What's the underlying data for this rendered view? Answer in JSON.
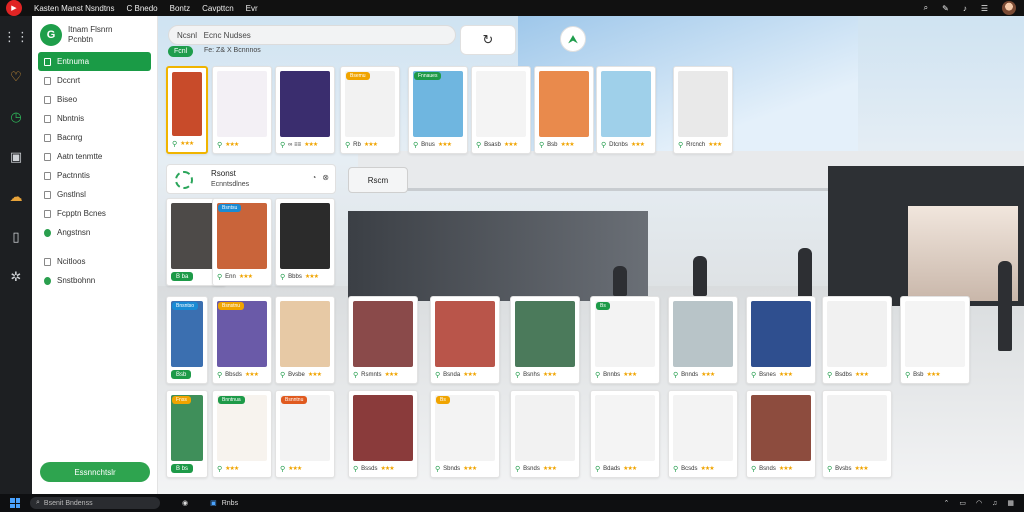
{
  "topbar": {
    "menu": [
      "Kasten Manst Nsndtns",
      "C Bnedo",
      "Bontz",
      "Cavpttcn",
      "Evr"
    ]
  },
  "sidebar": {
    "brand_line1": "Itnam Flsnrn",
    "brand_line2": "Pcnbtn",
    "items": [
      {
        "label": "Entnuma",
        "active": true
      },
      {
        "label": "Dccnrt"
      },
      {
        "label": "Biseo"
      },
      {
        "label": "Nbntnis"
      },
      {
        "label": "Bacnrg"
      },
      {
        "label": "Aatn tenmtte"
      },
      {
        "label": "Pactnntis"
      },
      {
        "label": "Gnstlnsl"
      },
      {
        "label": "Fcpptn Bcnes"
      },
      {
        "label": "Angstnsn"
      },
      {
        "label": "Ncitloos"
      },
      {
        "label": "Snstbohnn"
      }
    ],
    "bottom_button": "Essnnchtslr"
  },
  "search": {
    "value": "Ncsnl   Ecnc Nudses",
    "chip": "Fcnl",
    "subtext": "Fe: Z& X Bcnnnos"
  },
  "section": {
    "title": "Rsonst",
    "subtitle": "Ecnntsdlnes",
    "room_button": "Rscm"
  },
  "cards_row1": [
    {
      "tag": "",
      "foot": "",
      "pill": "",
      "thumb": "#c84b2a"
    },
    {
      "tag": "",
      "foot": "",
      "thumb": "#f3f0f5"
    },
    {
      "tag": "",
      "foot": "∞  ≡≡",
      "thumb": "#3a2d6e"
    },
    {
      "tag": "Bsemu",
      "foot": "Rb",
      "thumb": "#f2f2f2"
    },
    {
      "tag": "Fnnaues",
      "foot": "Bnus",
      "thumb": "#6fb6e0"
    },
    {
      "tag": "",
      "foot": "Bsasb",
      "thumb": "#f4f4f4"
    },
    {
      "tag": "",
      "foot": "Bsb",
      "thumb": "#e98a4c"
    },
    {
      "tag": "",
      "foot": "Dtcnbs",
      "thumb": "#9fd0ea"
    },
    {
      "tag": "",
      "foot": "Rrcnch",
      "thumb": "#e9e9e9"
    }
  ],
  "cards_row2": [
    {
      "tag": "",
      "pill": "B ba",
      "thumb": "#4d4a48"
    },
    {
      "tag": "Bsntsu",
      "foot": "Enn",
      "thumb": "#c9643a"
    },
    {
      "tag": "",
      "foot": "Bbbs",
      "thumb": "#2b2b2b"
    }
  ],
  "cards_row3": [
    {
      "tag": "Bnsntso",
      "pill": "Bsb",
      "thumb": "#3b6fb0"
    },
    {
      "tag": "Bsnstnu",
      "foot": "Bbsds",
      "thumb": "#6a5aa8"
    },
    {
      "tag": "",
      "foot": "Bvsbe",
      "thumb": "#e7c9a5"
    },
    {
      "tag": "",
      "foot": "Rsmnts",
      "thumb": "#8a4a4a"
    },
    {
      "tag": "",
      "foot": "Bsnda",
      "thumb": "#b9554a"
    },
    {
      "tag": "",
      "foot": "Bsnhs",
      "thumb": "#4b7a5b"
    },
    {
      "tag": "Bs",
      "foot": "Bnnbs",
      "thumb": "#f3f3f3"
    },
    {
      "tag": "",
      "foot": "Bnnds",
      "thumb": "#b8c4c8"
    },
    {
      "tag": "",
      "foot": "Bsnes",
      "thumb": "#2f4f8f"
    },
    {
      "tag": "",
      "foot": "Bsdbs",
      "thumb": "#f1f1f1"
    },
    {
      "tag": "",
      "foot": "Bsb",
      "thumb": "#f4f4f4"
    }
  ],
  "cards_row4": [
    {
      "tag": "Fnss",
      "pill": "B bs",
      "thumb": "#3f8f5a"
    },
    {
      "tag": "Bnntnua",
      "foot": "",
      "thumb": "#f7f3ee"
    },
    {
      "tag": "Bsnntnu",
      "foot": "",
      "thumb": "#f3f3f3"
    },
    {
      "tag": "",
      "foot": "Bssds",
      "thumb": "#8a3b3b"
    },
    {
      "tag": "Bs",
      "foot": "Sbnds",
      "thumb": "#f3f3f3"
    },
    {
      "tag": "",
      "foot": "Bsnds",
      "thumb": "#f2f2f2"
    },
    {
      "tag": "",
      "foot": "Bdads",
      "thumb": "#f4f4f4"
    },
    {
      "tag": "",
      "foot": "Bcsds",
      "thumb": "#f3f3f3"
    },
    {
      "tag": "",
      "foot": "Bsnds",
      "thumb": "#8d4c3e"
    },
    {
      "tag": "",
      "foot": "Bvsbs",
      "thumb": "#f2f2f2"
    }
  ],
  "taskbar": {
    "search_placeholder": "Bsenit Bndenss",
    "app_label": "Rnbs"
  }
}
